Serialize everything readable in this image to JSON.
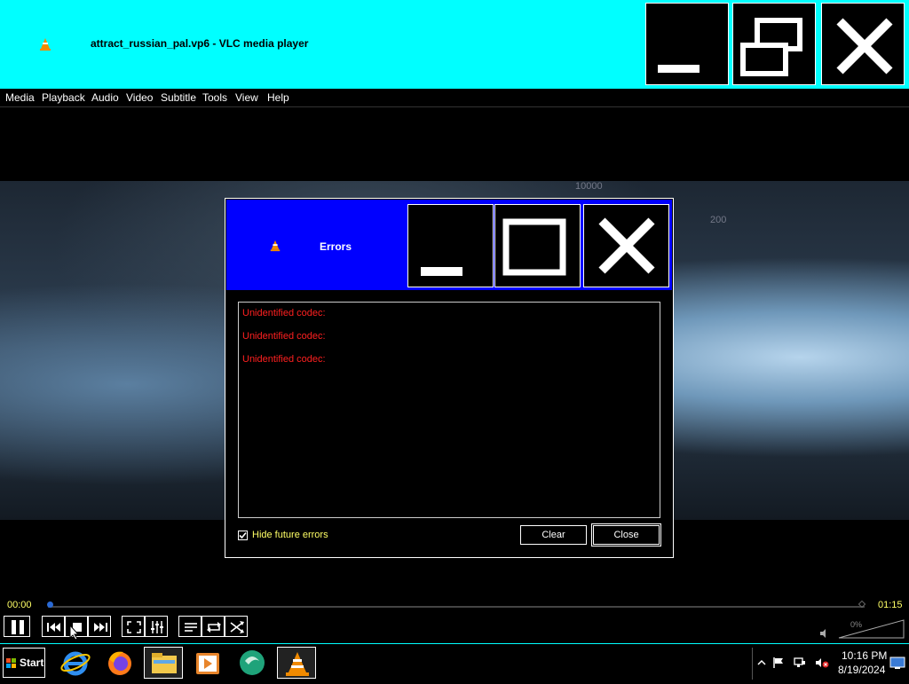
{
  "window": {
    "title": "attract_russian_pal.vp6 - VLC media player",
    "icon": "vlc-cone-icon"
  },
  "menu": [
    "Media",
    "Playback",
    "Audio",
    "Video",
    "Subtitle",
    "Tools",
    "View",
    "Help"
  ],
  "video_overlay": {
    "top_text": "10000",
    "dial_text": "200"
  },
  "dialog": {
    "title": "Errors",
    "errors": [
      "Unidentified codec:",
      "Unidentified codec:",
      "Unidentified codec:"
    ],
    "hide_label": "Hide future errors",
    "hide_checked": true,
    "clear_label": "Clear",
    "close_label": "Close"
  },
  "player": {
    "elapsed": "00:00",
    "total": "01:15",
    "volume": "0%"
  },
  "taskbar": {
    "start_label": "Start",
    "apps": [
      "internet-explorer-icon",
      "firefox-icon",
      "file-explorer-icon",
      "media-player-icon",
      "chat-app-icon",
      "vlc-cone-icon"
    ],
    "time": "10:16 PM",
    "date": "8/19/2024"
  },
  "colors": {
    "title_bar": "#00ffff",
    "dialog_title_bar": "#0000ff",
    "error_text": "#ff2020",
    "accent_text": "#ffff66"
  }
}
